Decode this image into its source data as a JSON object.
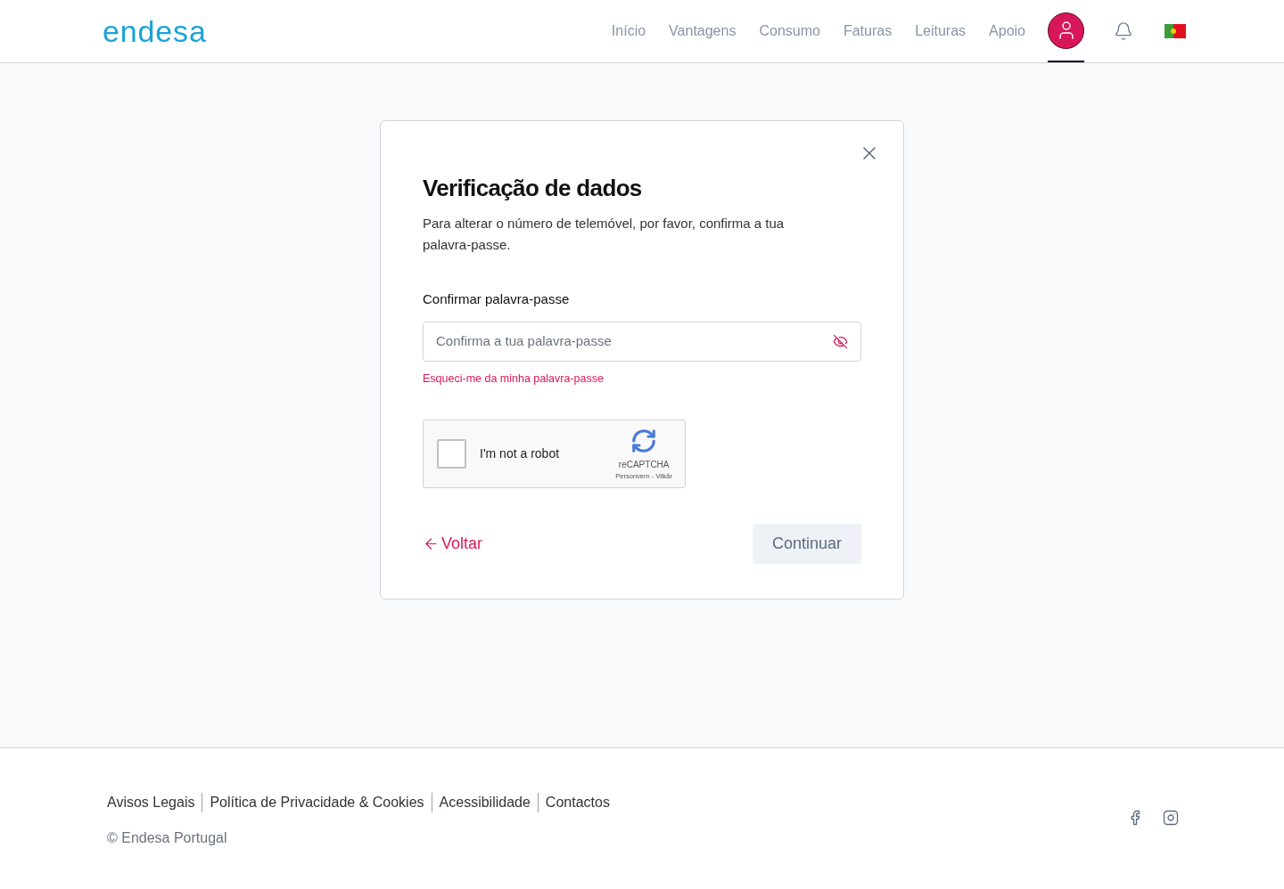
{
  "header": {
    "logo": "endesa",
    "nav": [
      {
        "label": "Início"
      },
      {
        "label": "Vantagens"
      },
      {
        "label": "Consumo"
      },
      {
        "label": "Faturas"
      },
      {
        "label": "Leituras"
      },
      {
        "label": "Apoio"
      }
    ],
    "account": {
      "selected": true
    }
  },
  "dialog": {
    "title": "Verificação de dados",
    "description": "Para alterar o número de telemóvel, por favor, confirma a tua palavra-passe.",
    "field_label": "Confirmar palavra-passe",
    "password": {
      "placeholder": "Confirma a tua palavra-passe"
    },
    "forgot_link": "Esqueci-me da minha palavra-passe",
    "captcha": {
      "checked": false,
      "label": "I'm not a robot",
      "brand": "reCAPTCHA",
      "terms": "Personvern - Vilkår"
    },
    "back": "Voltar",
    "continue": {
      "label": "Continuar",
      "disabled": true
    }
  },
  "footer": {
    "links": [
      "Avisos Legais",
      "Política de Privacidade & Cookies",
      "Acessibilidade",
      "Contactos"
    ],
    "copyright": "© Endesa Portugal"
  }
}
